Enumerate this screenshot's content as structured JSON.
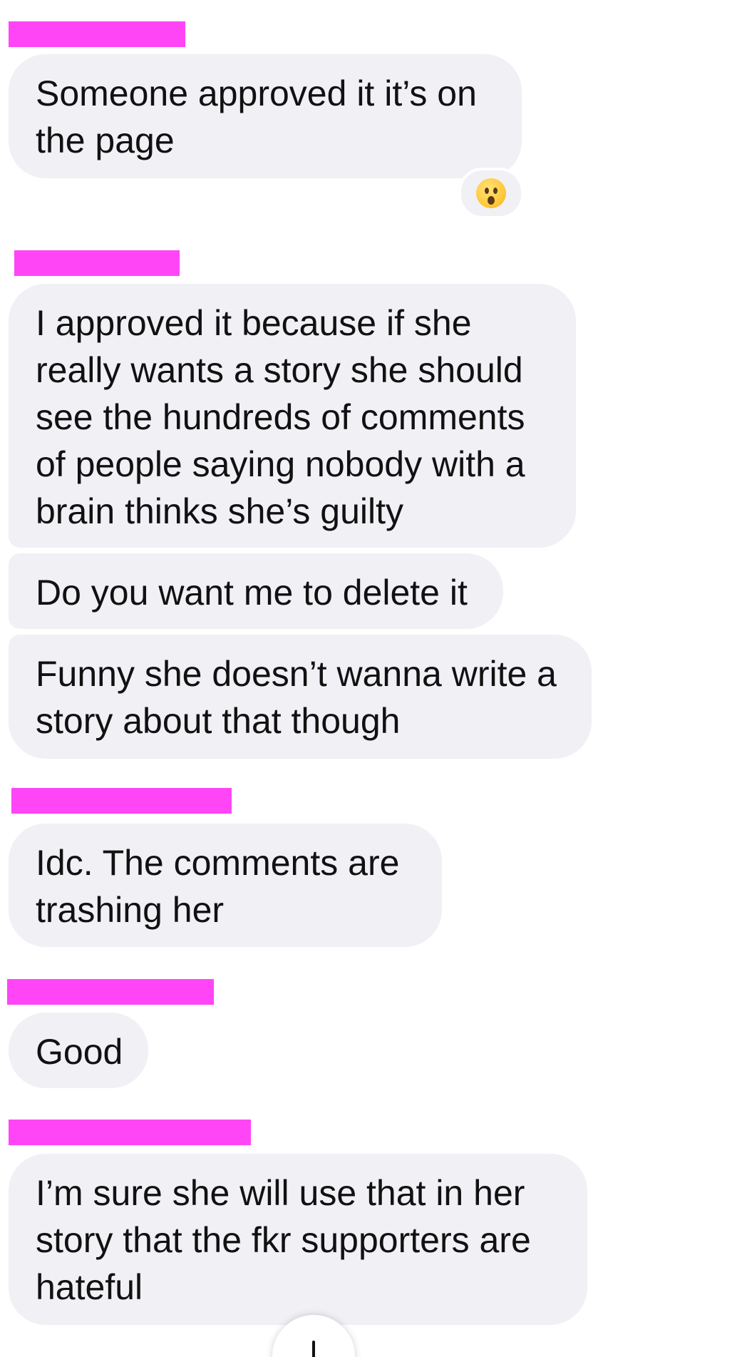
{
  "messages": [
    {
      "text": "Someone approved it it’s on\nthe page",
      "reaction": "astonished-face-emoji"
    },
    {
      "text": "I approved it because if she\nreally wants a story she should\nsee the hundreds of comments\nof people saying nobody with a\nbrain thinks she’s guilty"
    },
    {
      "text": "Do you want me to delete it"
    },
    {
      "text": "Funny she doesn’t wanna write a\nstory about that though"
    },
    {
      "text": "Idc. The comments are\ntrashing her"
    },
    {
      "text": "Good"
    },
    {
      "text": "I’m sure she will use that in her\nstory that the fkr supporters are\nhateful"
    }
  ],
  "colors": {
    "bubble": "#f0f0f5",
    "redaction": "#ff45f5",
    "text": "#111111"
  },
  "icons": {
    "reaction": "astonished-face-emoji",
    "scroll": "scroll-down-arrow-icon"
  }
}
